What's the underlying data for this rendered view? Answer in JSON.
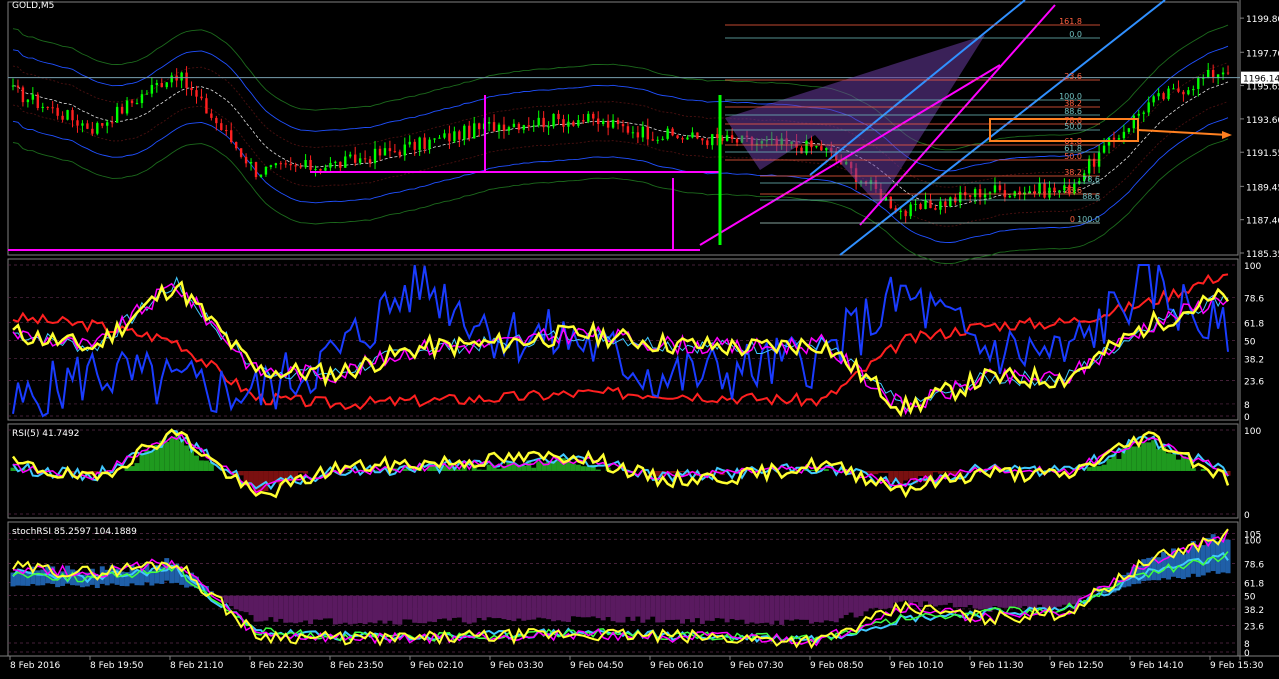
{
  "window": {
    "title": "GOLD,M5"
  },
  "colors": {
    "background": "#000000",
    "frame": "#808080",
    "grid": "#2a2a2a",
    "bull": "#00ff00",
    "bear": "#ff2020",
    "price_line": "#c0c0c0",
    "fib": "#ff6040",
    "fib2": "#70c0c0",
    "magenta": "#ff00ff",
    "channel": "#3090ff",
    "pattern_fill": "#6a3ca0",
    "orange": "#ff8020",
    "blue_main": "#1a3cff",
    "yellow": "#ffff30",
    "cyan": "#40c8ff",
    "hist_green": "#1f9a1f",
    "hist_red": "#7a1010",
    "hist_blue": "#1f5fa8",
    "hist_purple": "#5a1a60"
  },
  "main_panel": {
    "price_ticks": [
      "1199.80",
      "1197.70",
      "1195.65",
      "1193.60",
      "1191.55",
      "1189.45",
      "1187.40",
      "1185.35"
    ],
    "price_values": [
      1199.8,
      1197.7,
      1195.65,
      1193.6,
      1191.55,
      1189.45,
      1187.4,
      1185.35
    ],
    "current_price": "1196.14",
    "fib_upper": [
      "161.8",
      "0.0",
      "23.6",
      "100.0",
      "38.2",
      "88.6",
      "78.6",
      "50.0",
      "61.8",
      "61.8",
      "50.0"
    ],
    "fib_lower": [
      "38.2",
      "78.6",
      "23.6",
      "88.6",
      "0",
      "100.0"
    ]
  },
  "rsi_main_panel": {
    "ticks": [
      "100",
      "78.6",
      "61.8",
      "50",
      "38.2",
      "23.6",
      "8",
      "0"
    ]
  },
  "rsi5_panel": {
    "label": "RSI(5) 41.7492",
    "ticks": [
      "100",
      "0"
    ]
  },
  "stochrsi_panel": {
    "label": "stochRSI 85.2597 104.1889",
    "ticks": [
      "105",
      "100",
      "78.6",
      "61.8",
      "50",
      "38.2",
      "23.6",
      "8",
      "0"
    ]
  },
  "time_axis": [
    "8 Feb 2016",
    "8 Feb 19:50",
    "8 Feb 21:10",
    "8 Feb 22:30",
    "8 Feb 23:50",
    "9 Feb 02:10",
    "9 Feb 03:30",
    "9 Feb 04:50",
    "9 Feb 06:10",
    "9 Feb 07:30",
    "9 Feb 08:50",
    "9 Feb 10:10",
    "9 Feb 11:30",
    "9 Feb 12:50",
    "9 Feb 14:10",
    "9 Feb 15:30"
  ],
  "chart_data": [
    {
      "type": "line",
      "title": "GOLD,M5",
      "ylim": [
        1185.35,
        1200.3
      ],
      "x": [
        "8 Feb 2016",
        "8 Feb 19:50",
        "8 Feb 21:10",
        "8 Feb 22:30",
        "8 Feb 23:50",
        "9 Feb 02:10",
        "9 Feb 03:30",
        "9 Feb 04:50",
        "9 Feb 06:10",
        "9 Feb 07:30",
        "9 Feb 08:50",
        "9 Feb 10:10",
        "9 Feb 11:30",
        "9 Feb 12:50",
        "9 Feb 14:10",
        "9 Feb 15:30"
      ],
      "series": [
        {
          "values": [
            1195.3,
            1193.0,
            1196.5,
            1190.4,
            1190.8,
            1192.0,
            1193.3,
            1193.6,
            1192.6,
            1192.2,
            1191.8,
            1187.8,
            1189.2,
            1189.2,
            1194.5,
            1196.8
          ]
        }
      ]
    },
    {
      "type": "line",
      "ylim": [
        0,
        100
      ],
      "x": [
        "8 Feb 2016",
        "8 Feb 19:50",
        "8 Feb 21:10",
        "8 Feb 22:30",
        "8 Feb 23:50",
        "9 Feb 02:10",
        "9 Feb 03:30",
        "9 Feb 04:50",
        "9 Feb 06:10",
        "9 Feb 07:30",
        "9 Feb 08:50",
        "9 Feb 10:10",
        "9 Feb 11:30",
        "9 Feb 12:50",
        "9 Feb 14:10",
        "9 Feb 15:30"
      ],
      "series": [
        {
          "values": [
            55,
            45,
            88,
            30,
            28,
            45,
            48,
            55,
            48,
            45,
            48,
            5,
            25,
            25,
            60,
            80
          ]
        },
        {
          "values": [
            65,
            60,
            50,
            12,
            8,
            10,
            12,
            15,
            15,
            12,
            10,
            50,
            60,
            62,
            75,
            95
          ]
        },
        {
          "values": [
            5,
            30,
            20,
            15,
            40,
            90,
            55,
            50,
            25,
            30,
            40,
            80,
            45,
            40,
            90,
            50
          ]
        }
      ]
    },
    {
      "type": "line",
      "label": "RSI(5) 41.7492",
      "ylim": [
        0,
        100
      ],
      "x": [
        "8 Feb 2016",
        "8 Feb 19:50",
        "8 Feb 21:10",
        "8 Feb 22:30",
        "8 Feb 23:50",
        "9 Feb 02:10",
        "9 Feb 03:30",
        "9 Feb 04:50",
        "9 Feb 06:10",
        "9 Feb 07:30",
        "9 Feb 08:50",
        "9 Feb 10:10",
        "9 Feb 11:30",
        "9 Feb 12:50",
        "9 Feb 14:10",
        "9 Feb 15:30"
      ],
      "series": [
        {
          "values": [
            60,
            40,
            100,
            20,
            55,
            60,
            65,
            70,
            40,
            45,
            60,
            30,
            50,
            45,
            95,
            41.7
          ]
        },
        {
          "values": [
            55,
            45,
            95,
            30,
            50,
            55,
            60,
            65,
            45,
            50,
            55,
            35,
            55,
            50,
            90,
            50
          ]
        }
      ]
    },
    {
      "type": "line",
      "label": "stochRSI 85.2597 104.1889",
      "ylim": [
        0,
        110
      ],
      "x": [
        "8 Feb 2016",
        "8 Feb 19:50",
        "8 Feb 21:10",
        "8 Feb 22:30",
        "8 Feb 23:50",
        "9 Feb 02:10",
        "9 Feb 03:30",
        "9 Feb 04:50",
        "9 Feb 06:10",
        "9 Feb 07:30",
        "9 Feb 08:50",
        "9 Feb 10:10",
        "9 Feb 11:30",
        "9 Feb 12:50",
        "9 Feb 14:10",
        "9 Feb 15:30"
      ],
      "series": [
        {
          "values": [
            75,
            70,
            80,
            15,
            12,
            12,
            14,
            16,
            14,
            12,
            10,
            40,
            30,
            35,
            80,
            104.2
          ]
        },
        {
          "values": [
            70,
            65,
            75,
            18,
            14,
            13,
            15,
            18,
            15,
            13,
            12,
            30,
            35,
            38,
            70,
            85.3
          ]
        }
      ]
    }
  ]
}
